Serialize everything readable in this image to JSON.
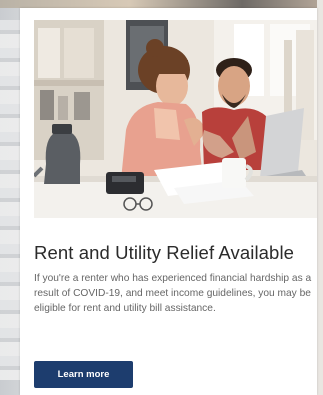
{
  "card": {
    "headline": "Rent and Utility Relief Available",
    "body": "If you're a renter who has experienced financial hardship as a result of COVID-19, and meet income guidelines, you may be eligible for rent and utility bill assistance.",
    "cta_label": "Learn more"
  },
  "colors": {
    "cta_background": "#1d3d6e",
    "headline": "#2b2b2b",
    "body_text": "#666666"
  }
}
